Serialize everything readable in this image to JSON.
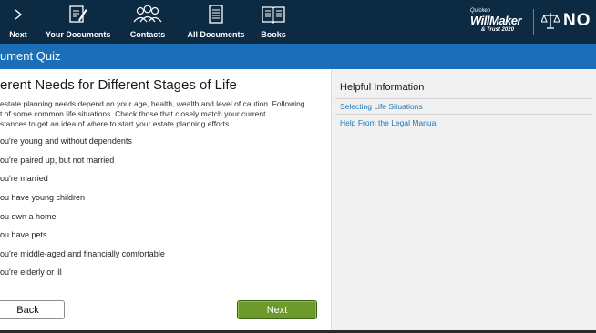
{
  "topnav": {
    "items": [
      {
        "label": "Next",
        "icon": "next-chevron-icon"
      },
      {
        "label": "Your Documents",
        "icon": "document-edit-icon"
      },
      {
        "label": "Contacts",
        "icon": "people-icon"
      },
      {
        "label": "All Documents",
        "icon": "documents-list-icon"
      },
      {
        "label": "Books",
        "icon": "book-icon"
      }
    ],
    "brand": {
      "top": "Quicken",
      "name": "WillMaker",
      "sub": "& Trust 2020"
    },
    "logo": "NO",
    "colors": {
      "bar": "#0d2a43",
      "title_bar": "#1b6fb8",
      "next_button": "#6c9b2c",
      "link": "#1c78b5"
    }
  },
  "title_bar": {
    "text": "ument Quiz"
  },
  "main": {
    "heading": "erent Needs for Different Stages of Life",
    "intro_lines": [
      "estate planning needs depend on your age, health, wealth and level of caution. Following",
      "t of some common life situations. Check those that closely match your current",
      "stances to get an idea of where to start your estate planning efforts."
    ],
    "options": [
      "ou're young and without dependents",
      "ou're paired up, but not married",
      "ou're married",
      "ou have young children",
      "ou own a home",
      "ou have pets",
      "ou're middle-aged and financially comfortable",
      "ou're elderly or ill"
    ],
    "back_label": "Back",
    "next_label": "Next"
  },
  "sidebar": {
    "title": "Helpful Information",
    "links": [
      "Selecting Life Situations",
      "Help From the Legal Manual"
    ]
  }
}
